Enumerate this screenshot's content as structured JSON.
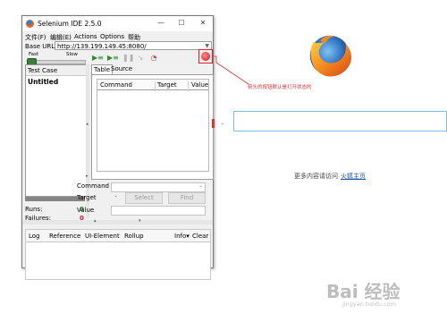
{
  "window": {
    "title": "Selenium IDE 2.5.0",
    "controls": {
      "minimize": "—",
      "maximize": "☐",
      "close": "✕"
    }
  },
  "menu": [
    "文件(F)",
    "编辑(E)",
    "Actions",
    "Options",
    "帮助"
  ],
  "base_url": {
    "label": "Base URL",
    "value": "http://139.199.149.45:8080/"
  },
  "speed": {
    "fast": "Fast",
    "slow": "Slow",
    "level": 0.05
  },
  "test_case_panel": {
    "header": "Test Case",
    "items": [
      "Untitled"
    ]
  },
  "stats": {
    "runs_label": "Runs:",
    "runs": "0",
    "failures_label": "Failures:",
    "failures": "0"
  },
  "editor_tabs": [
    "Table",
    "Source"
  ],
  "command_table": {
    "columns": [
      "Command",
      "Target",
      "Value"
    ]
  },
  "form": {
    "command_label": "Command",
    "target_label": "Target",
    "value_label": "Value",
    "select_button": "Select",
    "find_button": "Find"
  },
  "bottom_tabs": [
    "Log",
    "Reference",
    "UI-Element",
    "Rollup",
    "Info▾",
    "Clear"
  ],
  "annotation": {
    "text": "箭头的按钮默认是打开状态的",
    "color": "#e03030"
  },
  "browser": {
    "more_text": "更多内容请访问",
    "link_text": "火狐主页"
  },
  "watermark": {
    "brand": "Bai 经验",
    "url": "jingyan.baidu.com"
  },
  "colors": {
    "record": "#d11515",
    "runs": "#1a8a1a",
    "failures": "#c81e1e",
    "link": "#1a55a8"
  }
}
